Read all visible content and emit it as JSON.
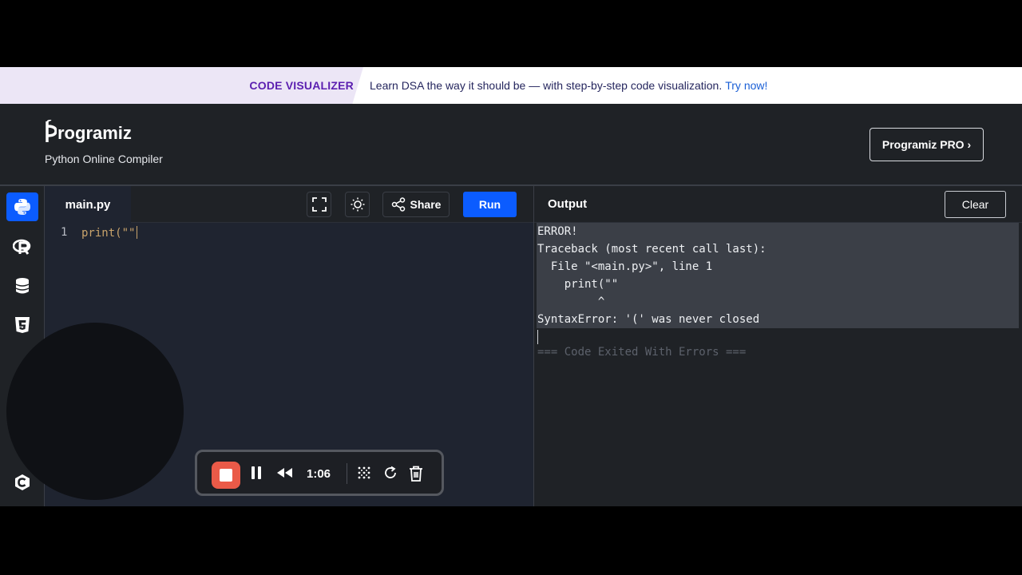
{
  "promo": {
    "tag": "CODE VISUALIZER",
    "text": "Learn DSA the way it should be — with step-by-step code visualization.",
    "link": "Try now!"
  },
  "header": {
    "logo_text": "rogramiz",
    "subtitle": "Python Online Compiler",
    "pro_button": "Programiz PRO ›"
  },
  "sidebar": {
    "items": [
      {
        "icon": "python-icon",
        "active": true
      },
      {
        "icon": "r-icon",
        "active": false
      },
      {
        "icon": "database-icon",
        "active": false
      },
      {
        "icon": "html5-icon",
        "active": false
      },
      {
        "icon": "c-icon",
        "active": false
      }
    ]
  },
  "editor": {
    "file_name": "main.py",
    "share_label": "Share",
    "run_label": "Run",
    "lines": [
      {
        "number": "1",
        "code": "print(\"\""
      }
    ]
  },
  "output": {
    "title": "Output",
    "clear_label": "Clear",
    "lines": [
      "ERROR!",
      "Traceback (most recent call last):",
      "  File \"<main.py>\", line 1",
      "    print(\"\"",
      "         ^",
      "SyntaxError: '(' was never closed"
    ],
    "exit_message": "=== Code Exited With Errors ==="
  },
  "recorder": {
    "time": "1:06"
  },
  "colors": {
    "accent": "#0b5cff",
    "promo_tag": "#5b1fb0",
    "record": "#ea5a48"
  }
}
